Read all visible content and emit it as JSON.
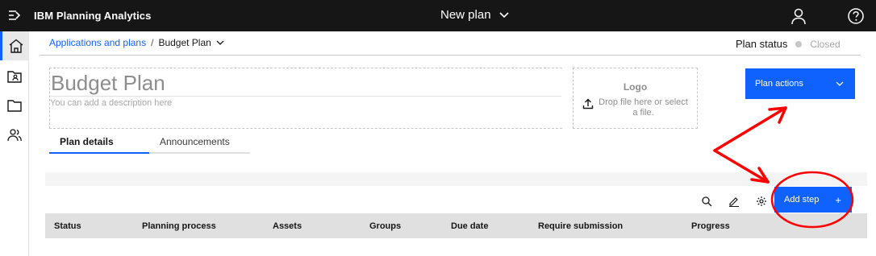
{
  "app": {
    "brand": "IBM Planning Analytics",
    "center_title": "New plan"
  },
  "breadcrumb": {
    "link": "Applications and plans",
    "separator": "/",
    "current": "Budget Plan"
  },
  "plan_status": {
    "label": "Plan status",
    "value": "Closed"
  },
  "plan": {
    "title": "Budget Plan",
    "description_placeholder": "You can add a description here"
  },
  "logo": {
    "title": "Logo",
    "drop_text_line1": "Drop file here or select",
    "drop_text_line2": "a file."
  },
  "actions": {
    "plan_actions": "Plan actions",
    "add_step": "Add step",
    "add_step_icon": "+"
  },
  "tabs": [
    {
      "label": "Plan details",
      "active": true
    },
    {
      "label": "Announcements",
      "active": false
    }
  ],
  "table": {
    "columns": [
      "Status",
      "Planning process",
      "Assets",
      "Groups",
      "Due date",
      "Require submission",
      "Progress"
    ]
  },
  "colors": {
    "accent": "#0f62fe",
    "topbar": "#161616",
    "annotation": "#ff0000"
  },
  "icons": {
    "topbar": [
      "menu-icon",
      "chevron-down-icon",
      "user-icon",
      "help-icon"
    ],
    "leftnav": [
      "home-icon",
      "contact-folder-icon",
      "folder-icon",
      "group-icon"
    ],
    "toolbar": [
      "search-icon",
      "edit-icon",
      "settings-icon"
    ]
  }
}
